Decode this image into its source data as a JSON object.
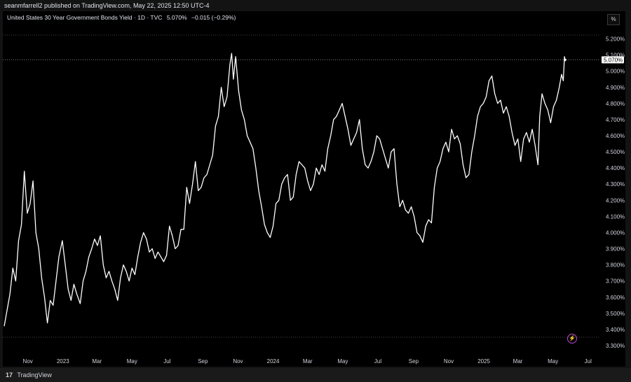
{
  "header": {
    "published": "seanmfarrell2 published on TradingView.com, May 22, 2025 12:50 UTC-4"
  },
  "legend": {
    "symbol": "United States 30 Year Government Bonds Yield · 1D · TVC",
    "value": "5.070%",
    "change": "−0.015 (−0.29%)"
  },
  "scale_button": "%",
  "footer": {
    "brand": "TradingView",
    "logo_glyph": "17"
  },
  "colors": {
    "background": "#000000",
    "line": "#ffffff",
    "grid_dotted": "#5a5a5a",
    "accent_bolt": "#b84bd3"
  },
  "chart_data": {
    "type": "line",
    "title": "United States 30 Year Government Bonds Yield · 1D · TVC",
    "xlabel": "",
    "ylabel": "",
    "ylim": [
      3.3,
      5.25
    ],
    "y_ticks": [
      "5.200%",
      "5.100%",
      "5.000%",
      "4.900%",
      "4.800%",
      "4.700%",
      "4.600%",
      "4.500%",
      "4.400%",
      "4.300%",
      "4.200%",
      "4.100%",
      "4.000%",
      "3.900%",
      "3.800%",
      "3.700%",
      "3.600%",
      "3.500%",
      "3.400%",
      "3.300%"
    ],
    "x_ticks": [
      {
        "label": "Nov",
        "x": "2022-11-01"
      },
      {
        "label": "2023",
        "x": "2023-01-01"
      },
      {
        "label": "Mar",
        "x": "2023-03-01"
      },
      {
        "label": "May",
        "x": "2023-05-01"
      },
      {
        "label": "Jul",
        "x": "2023-07-01"
      },
      {
        "label": "Sep",
        "x": "2023-09-01"
      },
      {
        "label": "Nov",
        "x": "2023-11-01"
      },
      {
        "label": "2024",
        "x": "2024-01-01"
      },
      {
        "label": "Mar",
        "x": "2024-03-01"
      },
      {
        "label": "May",
        "x": "2024-05-01"
      },
      {
        "label": "Jul",
        "x": "2024-07-01"
      },
      {
        "label": "Sep",
        "x": "2024-09-01"
      },
      {
        "label": "Nov",
        "x": "2024-11-01"
      },
      {
        "label": "2025",
        "x": "2025-01-01"
      },
      {
        "label": "Mar",
        "x": "2025-03-01"
      },
      {
        "label": "May",
        "x": "2025-05-01"
      },
      {
        "label": "Jul",
        "x": "2025-07-01"
      }
    ],
    "last_value_label": "5.070%",
    "series": [
      {
        "values": [
          {
            "x": "2022-09-21",
            "y": 3.42
          },
          {
            "x": "2022-09-26",
            "y": 3.52
          },
          {
            "x": "2022-10-01",
            "y": 3.62
          },
          {
            "x": "2022-10-06",
            "y": 3.78
          },
          {
            "x": "2022-10-11",
            "y": 3.7
          },
          {
            "x": "2022-10-16",
            "y": 3.95
          },
          {
            "x": "2022-10-21",
            "y": 4.05
          },
          {
            "x": "2022-10-26",
            "y": 4.38
          },
          {
            "x": "2022-10-31",
            "y": 4.12
          },
          {
            "x": "2022-11-05",
            "y": 4.18
          },
          {
            "x": "2022-11-10",
            "y": 4.32
          },
          {
            "x": "2022-11-15",
            "y": 4.0
          },
          {
            "x": "2022-11-20",
            "y": 3.9
          },
          {
            "x": "2022-11-25",
            "y": 3.72
          },
          {
            "x": "2022-11-30",
            "y": 3.6
          },
          {
            "x": "2022-12-05",
            "y": 3.44
          },
          {
            "x": "2022-12-10",
            "y": 3.58
          },
          {
            "x": "2022-12-15",
            "y": 3.55
          },
          {
            "x": "2022-12-20",
            "y": 3.7
          },
          {
            "x": "2022-12-25",
            "y": 3.85
          },
          {
            "x": "2022-12-31",
            "y": 3.95
          },
          {
            "x": "2023-01-05",
            "y": 3.8
          },
          {
            "x": "2023-01-10",
            "y": 3.65
          },
          {
            "x": "2023-01-15",
            "y": 3.58
          },
          {
            "x": "2023-01-20",
            "y": 3.68
          },
          {
            "x": "2023-01-25",
            "y": 3.62
          },
          {
            "x": "2023-01-31",
            "y": 3.56
          },
          {
            "x": "2023-02-05",
            "y": 3.7
          },
          {
            "x": "2023-02-10",
            "y": 3.76
          },
          {
            "x": "2023-02-15",
            "y": 3.85
          },
          {
            "x": "2023-02-20",
            "y": 3.9
          },
          {
            "x": "2023-02-25",
            "y": 3.96
          },
          {
            "x": "2023-03-02",
            "y": 3.92
          },
          {
            "x": "2023-03-07",
            "y": 3.98
          },
          {
            "x": "2023-03-12",
            "y": 3.8
          },
          {
            "x": "2023-03-17",
            "y": 3.72
          },
          {
            "x": "2023-03-22",
            "y": 3.76
          },
          {
            "x": "2023-03-27",
            "y": 3.7
          },
          {
            "x": "2023-04-01",
            "y": 3.65
          },
          {
            "x": "2023-04-06",
            "y": 3.58
          },
          {
            "x": "2023-04-11",
            "y": 3.72
          },
          {
            "x": "2023-04-16",
            "y": 3.8
          },
          {
            "x": "2023-04-21",
            "y": 3.76
          },
          {
            "x": "2023-04-26",
            "y": 3.7
          },
          {
            "x": "2023-05-01",
            "y": 3.78
          },
          {
            "x": "2023-05-06",
            "y": 3.74
          },
          {
            "x": "2023-05-11",
            "y": 3.85
          },
          {
            "x": "2023-05-16",
            "y": 3.94
          },
          {
            "x": "2023-05-21",
            "y": 4.0
          },
          {
            "x": "2023-05-26",
            "y": 3.96
          },
          {
            "x": "2023-05-31",
            "y": 3.88
          },
          {
            "x": "2023-06-05",
            "y": 3.9
          },
          {
            "x": "2023-06-10",
            "y": 3.84
          },
          {
            "x": "2023-06-15",
            "y": 3.88
          },
          {
            "x": "2023-06-20",
            "y": 3.85
          },
          {
            "x": "2023-06-25",
            "y": 3.82
          },
          {
            "x": "2023-06-30",
            "y": 3.86
          },
          {
            "x": "2023-07-05",
            "y": 4.04
          },
          {
            "x": "2023-07-10",
            "y": 3.98
          },
          {
            "x": "2023-07-15",
            "y": 3.9
          },
          {
            "x": "2023-07-20",
            "y": 3.92
          },
          {
            "x": "2023-07-25",
            "y": 4.02
          },
          {
            "x": "2023-07-30",
            "y": 4.02
          },
          {
            "x": "2023-08-04",
            "y": 4.28
          },
          {
            "x": "2023-08-09",
            "y": 4.18
          },
          {
            "x": "2023-08-14",
            "y": 4.3
          },
          {
            "x": "2023-08-19",
            "y": 4.44
          },
          {
            "x": "2023-08-24",
            "y": 4.26
          },
          {
            "x": "2023-08-29",
            "y": 4.28
          },
          {
            "x": "2023-09-03",
            "y": 4.34
          },
          {
            "x": "2023-09-08",
            "y": 4.36
          },
          {
            "x": "2023-09-13",
            "y": 4.42
          },
          {
            "x": "2023-09-18",
            "y": 4.48
          },
          {
            "x": "2023-09-23",
            "y": 4.66
          },
          {
            "x": "2023-09-28",
            "y": 4.72
          },
          {
            "x": "2023-10-03",
            "y": 4.9
          },
          {
            "x": "2023-10-08",
            "y": 4.78
          },
          {
            "x": "2023-10-13",
            "y": 4.84
          },
          {
            "x": "2023-10-18",
            "y": 5.04
          },
          {
            "x": "2023-10-21",
            "y": 5.11
          },
          {
            "x": "2023-10-24",
            "y": 4.95
          },
          {
            "x": "2023-10-28",
            "y": 5.09
          },
          {
            "x": "2023-11-02",
            "y": 4.88
          },
          {
            "x": "2023-11-07",
            "y": 4.76
          },
          {
            "x": "2023-11-12",
            "y": 4.7
          },
          {
            "x": "2023-11-17",
            "y": 4.6
          },
          {
            "x": "2023-11-22",
            "y": 4.56
          },
          {
            "x": "2023-11-27",
            "y": 4.52
          },
          {
            "x": "2023-12-02",
            "y": 4.4
          },
          {
            "x": "2023-12-07",
            "y": 4.26
          },
          {
            "x": "2023-12-12",
            "y": 4.16
          },
          {
            "x": "2023-12-17",
            "y": 4.05
          },
          {
            "x": "2023-12-22",
            "y": 4.0
          },
          {
            "x": "2023-12-27",
            "y": 3.97
          },
          {
            "x": "2024-01-01",
            "y": 4.04
          },
          {
            "x": "2024-01-06",
            "y": 4.18
          },
          {
            "x": "2024-01-11",
            "y": 4.2
          },
          {
            "x": "2024-01-16",
            "y": 4.3
          },
          {
            "x": "2024-01-21",
            "y": 4.34
          },
          {
            "x": "2024-01-26",
            "y": 4.36
          },
          {
            "x": "2024-01-31",
            "y": 4.2
          },
          {
            "x": "2024-02-05",
            "y": 4.22
          },
          {
            "x": "2024-02-10",
            "y": 4.36
          },
          {
            "x": "2024-02-15",
            "y": 4.44
          },
          {
            "x": "2024-02-20",
            "y": 4.42
          },
          {
            "x": "2024-02-25",
            "y": 4.4
          },
          {
            "x": "2024-03-01",
            "y": 4.32
          },
          {
            "x": "2024-03-06",
            "y": 4.26
          },
          {
            "x": "2024-03-11",
            "y": 4.3
          },
          {
            "x": "2024-03-16",
            "y": 4.4
          },
          {
            "x": "2024-03-21",
            "y": 4.36
          },
          {
            "x": "2024-03-26",
            "y": 4.42
          },
          {
            "x": "2024-03-31",
            "y": 4.38
          },
          {
            "x": "2024-04-05",
            "y": 4.52
          },
          {
            "x": "2024-04-10",
            "y": 4.6
          },
          {
            "x": "2024-04-15",
            "y": 4.7
          },
          {
            "x": "2024-04-20",
            "y": 4.72
          },
          {
            "x": "2024-04-25",
            "y": 4.76
          },
          {
            "x": "2024-04-30",
            "y": 4.8
          },
          {
            "x": "2024-05-05",
            "y": 4.72
          },
          {
            "x": "2024-05-10",
            "y": 4.64
          },
          {
            "x": "2024-05-15",
            "y": 4.54
          },
          {
            "x": "2024-05-20",
            "y": 4.58
          },
          {
            "x": "2024-05-25",
            "y": 4.62
          },
          {
            "x": "2024-05-30",
            "y": 4.7
          },
          {
            "x": "2024-06-04",
            "y": 4.52
          },
          {
            "x": "2024-06-09",
            "y": 4.42
          },
          {
            "x": "2024-06-14",
            "y": 4.4
          },
          {
            "x": "2024-06-19",
            "y": 4.44
          },
          {
            "x": "2024-06-24",
            "y": 4.5
          },
          {
            "x": "2024-06-29",
            "y": 4.6
          },
          {
            "x": "2024-07-04",
            "y": 4.58
          },
          {
            "x": "2024-07-09",
            "y": 4.52
          },
          {
            "x": "2024-07-14",
            "y": 4.46
          },
          {
            "x": "2024-07-19",
            "y": 4.4
          },
          {
            "x": "2024-07-24",
            "y": 4.5
          },
          {
            "x": "2024-07-29",
            "y": 4.52
          },
          {
            "x": "2024-08-03",
            "y": 4.3
          },
          {
            "x": "2024-08-08",
            "y": 4.16
          },
          {
            "x": "2024-08-13",
            "y": 4.2
          },
          {
            "x": "2024-08-18",
            "y": 4.14
          },
          {
            "x": "2024-08-23",
            "y": 4.12
          },
          {
            "x": "2024-08-28",
            "y": 4.16
          },
          {
            "x": "2024-09-02",
            "y": 4.1
          },
          {
            "x": "2024-09-07",
            "y": 4.0
          },
          {
            "x": "2024-09-12",
            "y": 3.98
          },
          {
            "x": "2024-09-17",
            "y": 3.94
          },
          {
            "x": "2024-09-22",
            "y": 4.04
          },
          {
            "x": "2024-09-27",
            "y": 4.08
          },
          {
            "x": "2024-10-02",
            "y": 4.06
          },
          {
            "x": "2024-10-07",
            "y": 4.28
          },
          {
            "x": "2024-10-12",
            "y": 4.4
          },
          {
            "x": "2024-10-17",
            "y": 4.44
          },
          {
            "x": "2024-10-22",
            "y": 4.52
          },
          {
            "x": "2024-10-27",
            "y": 4.56
          },
          {
            "x": "2024-11-01",
            "y": 4.5
          },
          {
            "x": "2024-11-06",
            "y": 4.64
          },
          {
            "x": "2024-11-11",
            "y": 4.58
          },
          {
            "x": "2024-11-16",
            "y": 4.6
          },
          {
            "x": "2024-11-21",
            "y": 4.55
          },
          {
            "x": "2024-11-26",
            "y": 4.42
          },
          {
            "x": "2024-12-01",
            "y": 4.34
          },
          {
            "x": "2024-12-06",
            "y": 4.36
          },
          {
            "x": "2024-12-11",
            "y": 4.5
          },
          {
            "x": "2024-12-16",
            "y": 4.6
          },
          {
            "x": "2024-12-21",
            "y": 4.72
          },
          {
            "x": "2024-12-26",
            "y": 4.78
          },
          {
            "x": "2024-12-31",
            "y": 4.8
          },
          {
            "x": "2025-01-05",
            "y": 4.84
          },
          {
            "x": "2025-01-10",
            "y": 4.94
          },
          {
            "x": "2025-01-15",
            "y": 4.97
          },
          {
            "x": "2025-01-20",
            "y": 4.86
          },
          {
            "x": "2025-01-25",
            "y": 4.8
          },
          {
            "x": "2025-01-30",
            "y": 4.82
          },
          {
            "x": "2025-02-04",
            "y": 4.74
          },
          {
            "x": "2025-02-09",
            "y": 4.78
          },
          {
            "x": "2025-02-14",
            "y": 4.72
          },
          {
            "x": "2025-02-19",
            "y": 4.62
          },
          {
            "x": "2025-02-24",
            "y": 4.54
          },
          {
            "x": "2025-03-01",
            "y": 4.58
          },
          {
            "x": "2025-03-06",
            "y": 4.44
          },
          {
            "x": "2025-03-11",
            "y": 4.58
          },
          {
            "x": "2025-03-16",
            "y": 4.62
          },
          {
            "x": "2025-03-21",
            "y": 4.56
          },
          {
            "x": "2025-03-26",
            "y": 4.64
          },
          {
            "x": "2025-03-31",
            "y": 4.54
          },
          {
            "x": "2025-04-05",
            "y": 4.42
          },
          {
            "x": "2025-04-08",
            "y": 4.72
          },
          {
            "x": "2025-04-12",
            "y": 4.86
          },
          {
            "x": "2025-04-17",
            "y": 4.8
          },
          {
            "x": "2025-04-22",
            "y": 4.76
          },
          {
            "x": "2025-04-27",
            "y": 4.68
          },
          {
            "x": "2025-05-02",
            "y": 4.78
          },
          {
            "x": "2025-05-07",
            "y": 4.82
          },
          {
            "x": "2025-05-12",
            "y": 4.9
          },
          {
            "x": "2025-05-16",
            "y": 4.98
          },
          {
            "x": "2025-05-19",
            "y": 4.94
          },
          {
            "x": "2025-05-21",
            "y": 5.09
          },
          {
            "x": "2025-05-22",
            "y": 5.07
          }
        ]
      }
    ],
    "grid": false
  }
}
